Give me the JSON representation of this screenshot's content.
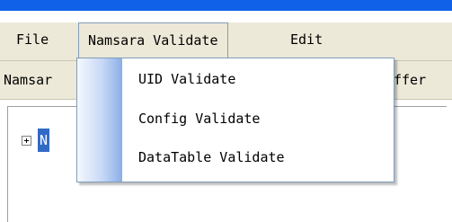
{
  "menubar": {
    "items": [
      {
        "label": "File"
      },
      {
        "label": "Namsara Validate"
      },
      {
        "label": "Edit"
      }
    ]
  },
  "toolbar": {
    "left_text": "Namsar",
    "right_text": "ffer"
  },
  "tree": {
    "node_label": "N"
  },
  "dropdown": {
    "items": [
      {
        "label": "UID Validate"
      },
      {
        "label": "Config Validate"
      },
      {
        "label": "DataTable Validate"
      }
    ]
  }
}
